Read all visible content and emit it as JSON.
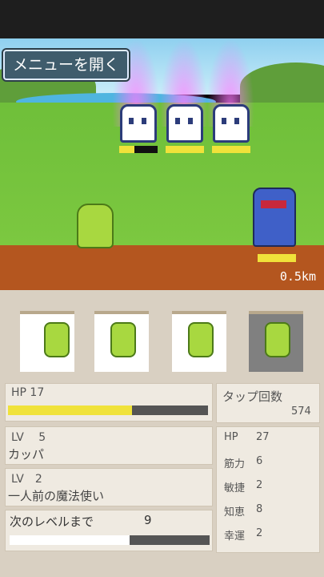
{
  "menu": {
    "label": "メニューを開く"
  },
  "battle": {
    "distance": "0.5km",
    "enemies": [
      {
        "hp_fraction": 0.4
      },
      {
        "hp_fraction": 1.0
      },
      {
        "hp_fraction": 1.0
      }
    ],
    "player_hp_fraction": 1.0
  },
  "skills": [
    "water-jet",
    "water-shot",
    "whirlpool",
    "rain-summon"
  ],
  "status": {
    "hp_label": "HP 17",
    "hp_fraction": 0.62,
    "level": "LV　 5",
    "name": "カッパ",
    "rank_level": "LV　2",
    "title": "一人前の魔法使い",
    "next_label": "次のレベルまで",
    "next_value": "9",
    "next_fraction": 0.6
  },
  "tap": {
    "label": "タップ回数",
    "count": "574"
  },
  "stats": [
    {
      "label": "HP",
      "value": "27"
    },
    {
      "label": "筋力",
      "value": "6"
    },
    {
      "label": "敏捷",
      "value": "2"
    },
    {
      "label": "知恵",
      "value": "8"
    },
    {
      "label": "幸運",
      "value": "2"
    }
  ]
}
